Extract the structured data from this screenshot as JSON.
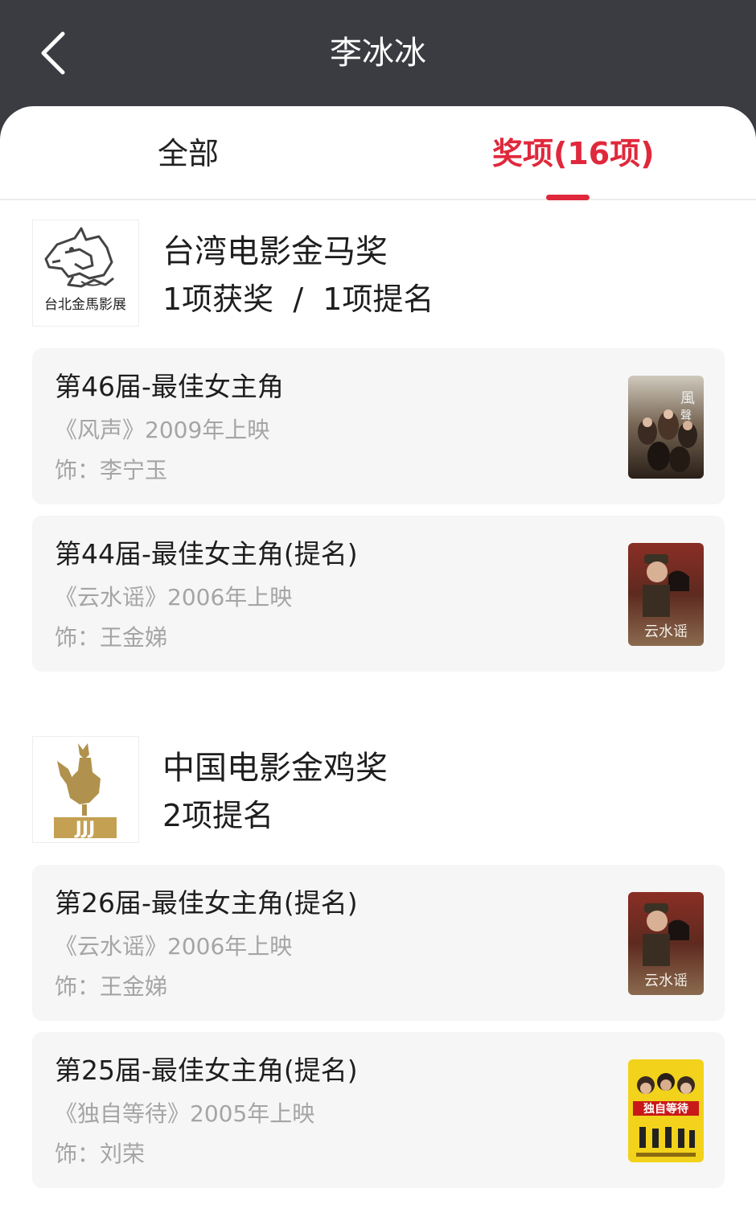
{
  "header": {
    "title": "李冰冰",
    "back_icon": "chevron-left-icon"
  },
  "tabs": [
    {
      "label": "全部",
      "active": false
    },
    {
      "label": "奖项(16项)",
      "active": true
    }
  ],
  "colors": {
    "accent": "#e0283c",
    "header_bg": "#3a3c41",
    "card_bg": "#f6f6f6",
    "muted_text": "#a5a5a5"
  },
  "sections": [
    {
      "name": "台湾电影金马奖",
      "stats": "1项获奖  /  1项提名",
      "logo_text": "台北金馬影展",
      "logo_icon": "golden-horse-logo-icon",
      "awards": [
        {
          "title": "第46届-最佳女主角",
          "film": "《风声》2009年上映",
          "role": "饰：李宁玉",
          "poster_icon": "film-poster-fengsheng"
        },
        {
          "title": "第44届-最佳女主角(提名)",
          "film": "《云水谣》2006年上映",
          "role": "饰：王金娣",
          "poster_icon": "film-poster-yunshuiyao"
        }
      ]
    },
    {
      "name": "中国电影金鸡奖",
      "stats": "2项提名",
      "logo_text": "JJJ",
      "logo_icon": "golden-rooster-logo-icon",
      "awards": [
        {
          "title": "第26届-最佳女主角(提名)",
          "film": "《云水谣》2006年上映",
          "role": "饰：王金娣",
          "poster_icon": "film-poster-yunshuiyao"
        },
        {
          "title": "第25届-最佳女主角(提名)",
          "film": "《独自等待》2005年上映",
          "role": "饰：刘荣",
          "poster_icon": "film-poster-duzidengdai"
        }
      ]
    }
  ]
}
